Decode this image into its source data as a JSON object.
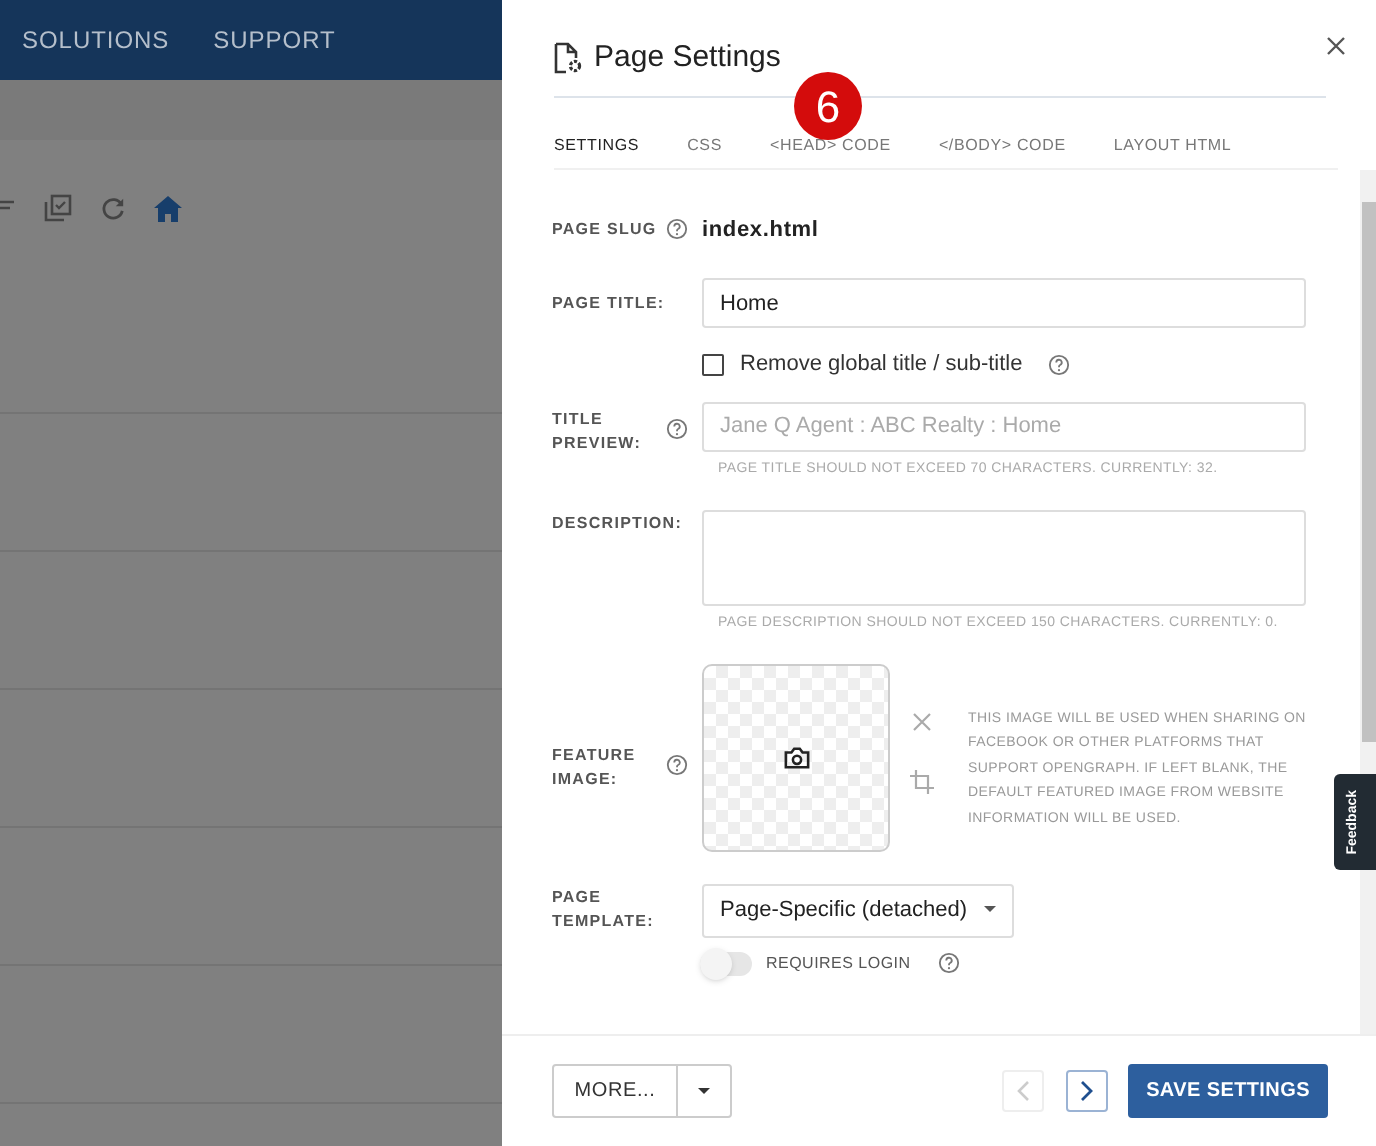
{
  "top_nav": {
    "items": [
      "SOLUTIONS",
      "SUPPORT"
    ]
  },
  "dialog": {
    "title": "Page Settings",
    "step_badge": "6",
    "tabs": [
      {
        "label": "SETTINGS",
        "selected": true
      },
      {
        "label": "CSS",
        "selected": false
      },
      {
        "label": "<HEAD> CODE",
        "selected": false
      },
      {
        "label": "</BODY> CODE",
        "selected": false
      },
      {
        "label": "LAYOUT HTML",
        "selected": false
      }
    ],
    "page_slug": {
      "label": "PAGE SLUG",
      "value": "index.html"
    },
    "page_title": {
      "label": "PAGE TITLE:",
      "value": "Home"
    },
    "remove_global_title": {
      "label": "Remove global title / sub-title",
      "checked": false
    },
    "title_preview": {
      "label": "TITLE PREVIEW:",
      "placeholder": "Jane Q Agent : ABC Realty : Home",
      "hint": "PAGE TITLE SHOULD NOT EXCEED 70 CHARACTERS. CURRENTLY: 32."
    },
    "description": {
      "label": "DESCRIPTION:",
      "hint": "PAGE DESCRIPTION SHOULD NOT EXCEED 150 CHARACTERS. CURRENTLY: 0."
    },
    "feature_image": {
      "label": "FEATURE IMAGE:",
      "note": "THIS IMAGE WILL BE USED WHEN SHARING ON FACEBOOK OR OTHER PLATFORMS THAT SUPPORT OPENGRAPH. IF LEFT BLANK, THE DEFAULT FEATURED IMAGE FROM WEBSITE INFORMATION WILL BE USED."
    },
    "page_template": {
      "label": "PAGE TEMPLATE:",
      "value": "Page-Specific (detached)"
    },
    "requires_login": {
      "label": "REQUIRES LOGIN",
      "on": false
    },
    "footer": {
      "more": "MORE...",
      "prev_disabled": true,
      "next_disabled": false,
      "save": "SAVE SETTINGS"
    },
    "feedback_tab": "Feedback"
  }
}
